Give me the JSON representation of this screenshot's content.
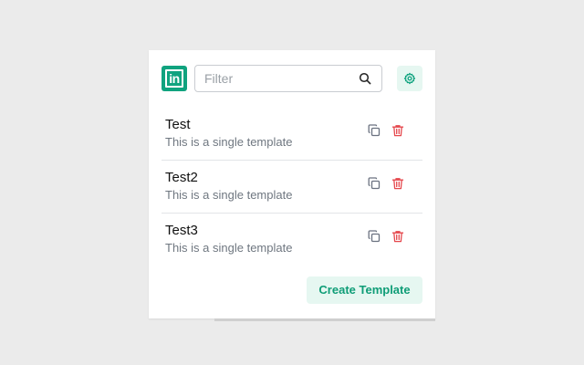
{
  "header": {
    "logo_text": "in",
    "logo_icon": "linkedin-logo-icon",
    "filter_placeholder": "Filter",
    "filter_value": "",
    "search_icon": "search-icon",
    "settings_icon": "gear-icon"
  },
  "templates": [
    {
      "name": "Test",
      "description": "This is a single template"
    },
    {
      "name": "Test2",
      "description": "This is a single template"
    },
    {
      "name": "Test3",
      "description": "This is a single template"
    }
  ],
  "item_actions": {
    "copy_icon": "copy-icon",
    "delete_icon": "trash-icon"
  },
  "footer": {
    "create_label": "Create Template"
  },
  "colors": {
    "accent": "#10a37f",
    "accent_light": "#e6f7f1",
    "accent_text": "#0f9d77",
    "danger": "#e5484d",
    "muted_text": "#6f7780",
    "background": "#ebebeb"
  }
}
